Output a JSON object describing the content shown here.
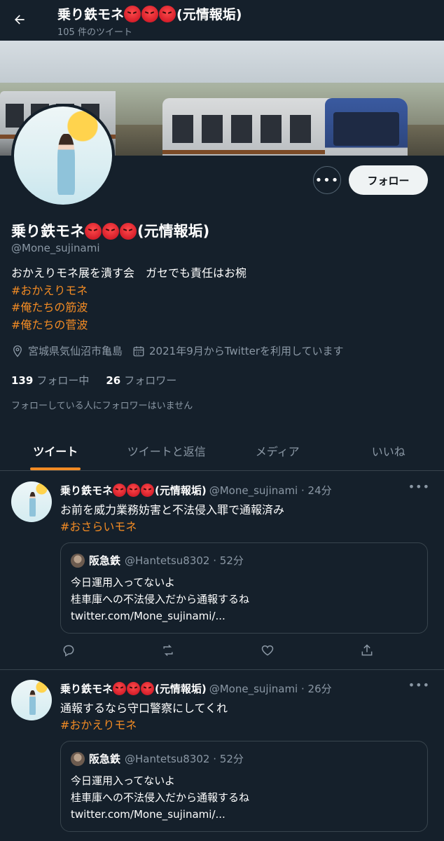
{
  "header": {
    "back_icon": "arrow-left-icon",
    "title": "乗り鉄モネ",
    "title_suffix": "(元情報垢)",
    "angry_emoji_count": 3,
    "tweet_count": "105 件のツイート"
  },
  "profile": {
    "name": "乗り鉄モネ",
    "name_suffix": "(元情報垢)",
    "handle": "@Mone_sujinami",
    "bio_text": "おかえりモネ展を潰す会　ガセでも責任はお椀",
    "bio_tags": [
      "#おかえりモネ",
      "#俺たちの筋波",
      "#俺たちの菅波"
    ],
    "location": "宮城県気仙沼市亀島",
    "joined": "2021年9月からTwitterを利用しています",
    "following_count": "139",
    "following_label": "フォロー中",
    "followers_count": "26",
    "followers_label": "フォロワー",
    "followers_note": "フォローしている人にフォロワーはいません",
    "follow_button": "フォロー",
    "more_icon": "more-horizontal-icon"
  },
  "tabs": [
    {
      "label": "ツイート",
      "active": true
    },
    {
      "label": "ツイートと返信",
      "active": false
    },
    {
      "label": "メディア",
      "active": false
    },
    {
      "label": "いいね",
      "active": false
    }
  ],
  "tweets": [
    {
      "name": "乗り鉄モネ",
      "name_suffix": "(元情報垢)",
      "meta": "@Mone_sujinami · 24分",
      "text": "お前を威力業務妨害と不法侵入罪で通報済み",
      "tag": "#おさらいモネ",
      "quote": {
        "name": "阪急鉄",
        "meta": "@Hantetsu8302 · 52分",
        "lines": [
          "今日運用入ってないよ",
          "桂車庫への不法侵入だから通報するね",
          "twitter.com/Mone_sujinami/..."
        ]
      }
    },
    {
      "name": "乗り鉄モネ",
      "name_suffix": "(元情報垢)",
      "meta": "@Mone_sujinami · 26分",
      "text": "通報するなら守口警察にしてくれ",
      "tag": "#おかえりモネ",
      "quote": {
        "name": "阪急鉄",
        "meta": "@Hantetsu8302 · 52分",
        "lines": [
          "今日運用入ってないよ",
          "桂車庫への不法侵入だから通報するね",
          "twitter.com/Mone_sujinami/..."
        ]
      }
    }
  ],
  "colors": {
    "background": "#15202b",
    "accent": "#f28b24",
    "secondary_text": "#8b98a5",
    "border": "#38444d"
  }
}
